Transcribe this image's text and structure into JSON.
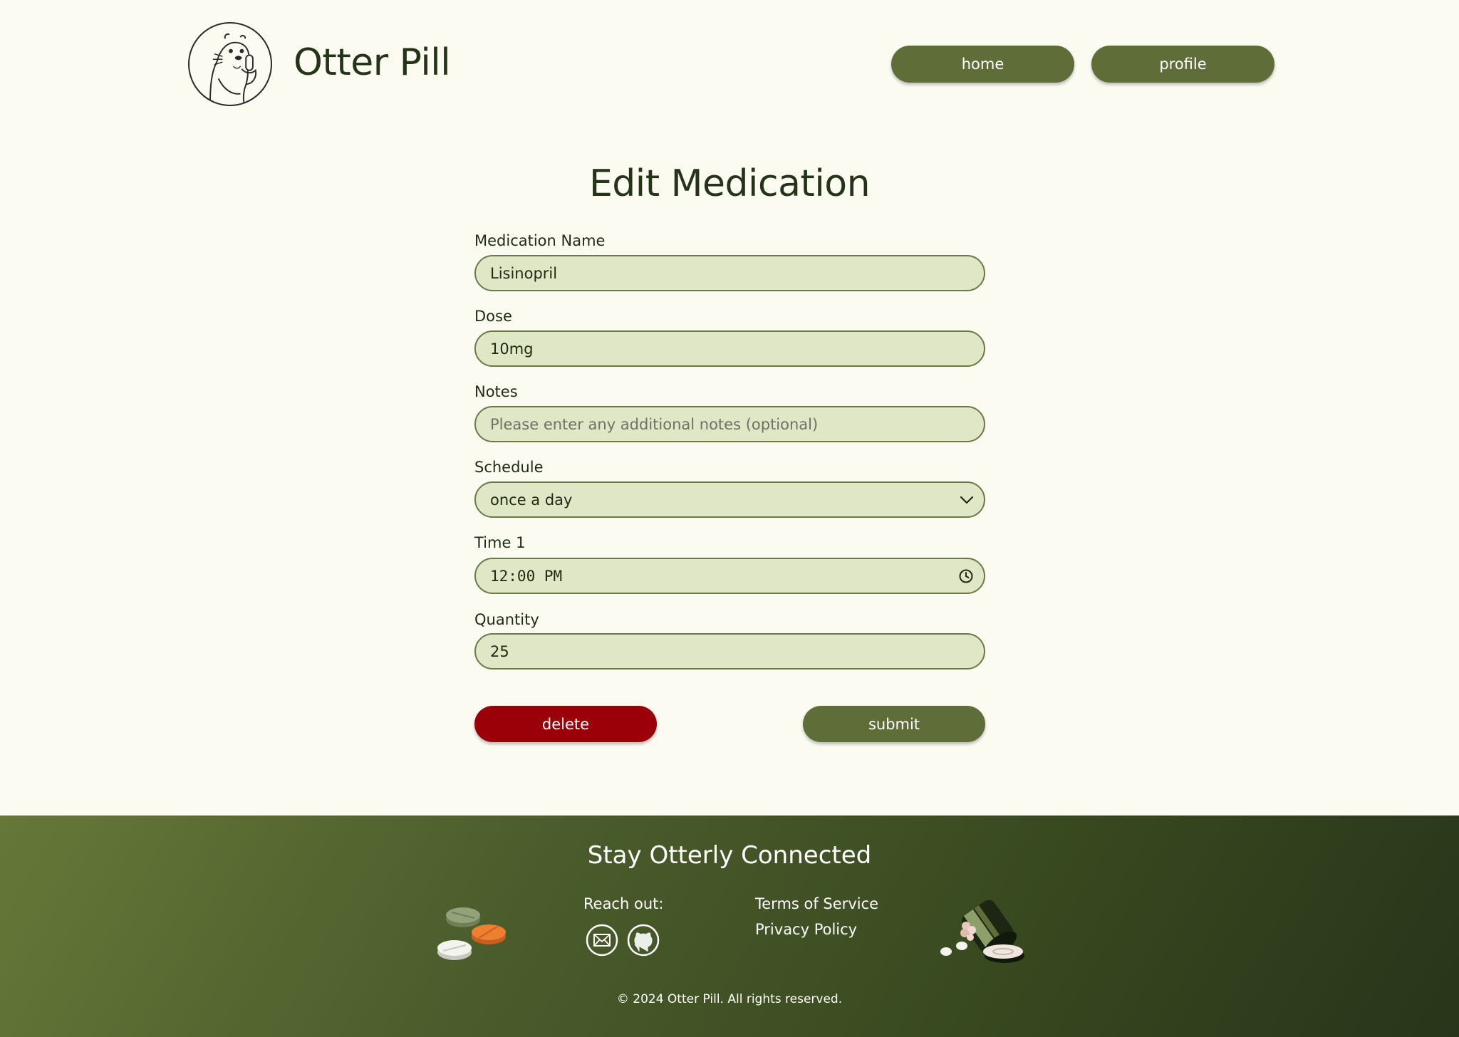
{
  "header": {
    "brand": "Otter Pill",
    "nav": {
      "home_label": "home",
      "profile_label": "profile"
    }
  },
  "form": {
    "title": "Edit Medication",
    "medication_name": {
      "label": "Medication Name",
      "value": "Lisinopril"
    },
    "dose": {
      "label": "Dose",
      "value": "10mg"
    },
    "notes": {
      "label": "Notes",
      "value": "",
      "placeholder": "Please enter any additional notes (optional)"
    },
    "schedule": {
      "label": "Schedule",
      "value": "once a day"
    },
    "time1": {
      "label": "Time 1",
      "value": "12:00 PM"
    },
    "quantity": {
      "label": "Quantity",
      "value": "25"
    },
    "delete_label": "delete",
    "submit_label": "submit"
  },
  "footer": {
    "title": "Stay Otterly Connected",
    "reach_out": "Reach out:",
    "links": {
      "terms": "Terms of Service",
      "privacy": "Privacy Policy"
    },
    "copyright": "© 2024 Otter Pill. All rights reserved."
  },
  "icons": {
    "logo": "otter-logo-icon",
    "schedule_dropdown": "chevron-down-icon",
    "time_picker": "clock-icon",
    "email": "mail-icon",
    "github": "github-icon"
  },
  "colors": {
    "background": "#fbfbf1",
    "primary_green": "#5f6e39",
    "input_fill": "#dfe7c7",
    "delete_red": "#9b0008",
    "text_dark": "#243417"
  }
}
